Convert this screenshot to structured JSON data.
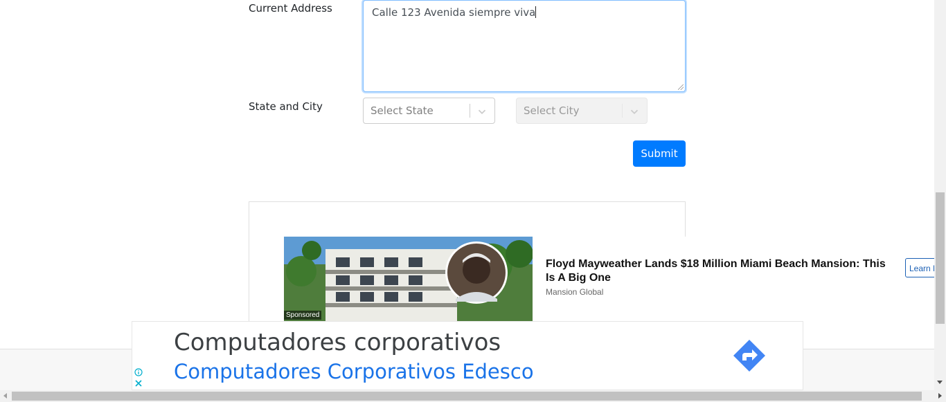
{
  "form": {
    "address_label": "Current Address",
    "address_value": "Calle 123 Avenida siempre viva",
    "state_city_label": "State and City",
    "state_placeholder": "Select State",
    "city_placeholder": "Select City",
    "submit_label": "Submit"
  },
  "promo": {
    "sponsored_label": "Sponsored",
    "title": "Floyd Mayweather Lands $18 Million Miami Beach Mansion: This Is A Big One",
    "source": "Mansion Global",
    "cta_label": "Learn M"
  },
  "banner_ad": {
    "headline": "Computadores corporativos",
    "subheadline": "Computadores Corporativos Edesco",
    "info_icon": "info-icon",
    "close_icon": "close-icon",
    "arrow_icon": "directions-arrow-icon",
    "accent_color": "#4285f4"
  },
  "colors": {
    "primary": "#007bff",
    "focus_border": "#80bdff"
  }
}
